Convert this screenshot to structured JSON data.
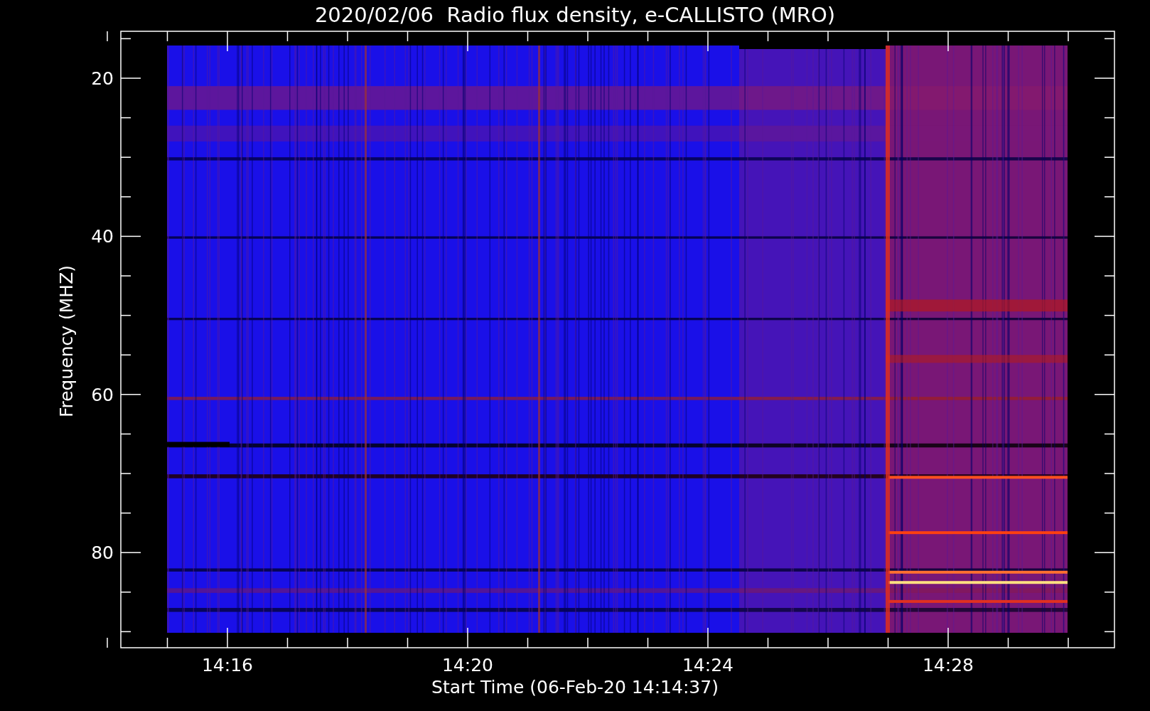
{
  "title": "2020/02/06  Radio flux density, e-CALLISTO (MRO)",
  "y_axis": {
    "label": "Frequency (MHZ)",
    "ticks": [
      "20",
      "40",
      "60",
      "80"
    ]
  },
  "x_axis": {
    "label": "Start Time (06-Feb-20 14:14:37)",
    "ticks": [
      "14:16",
      "14:20",
      "14:24",
      "14:28"
    ]
  }
}
